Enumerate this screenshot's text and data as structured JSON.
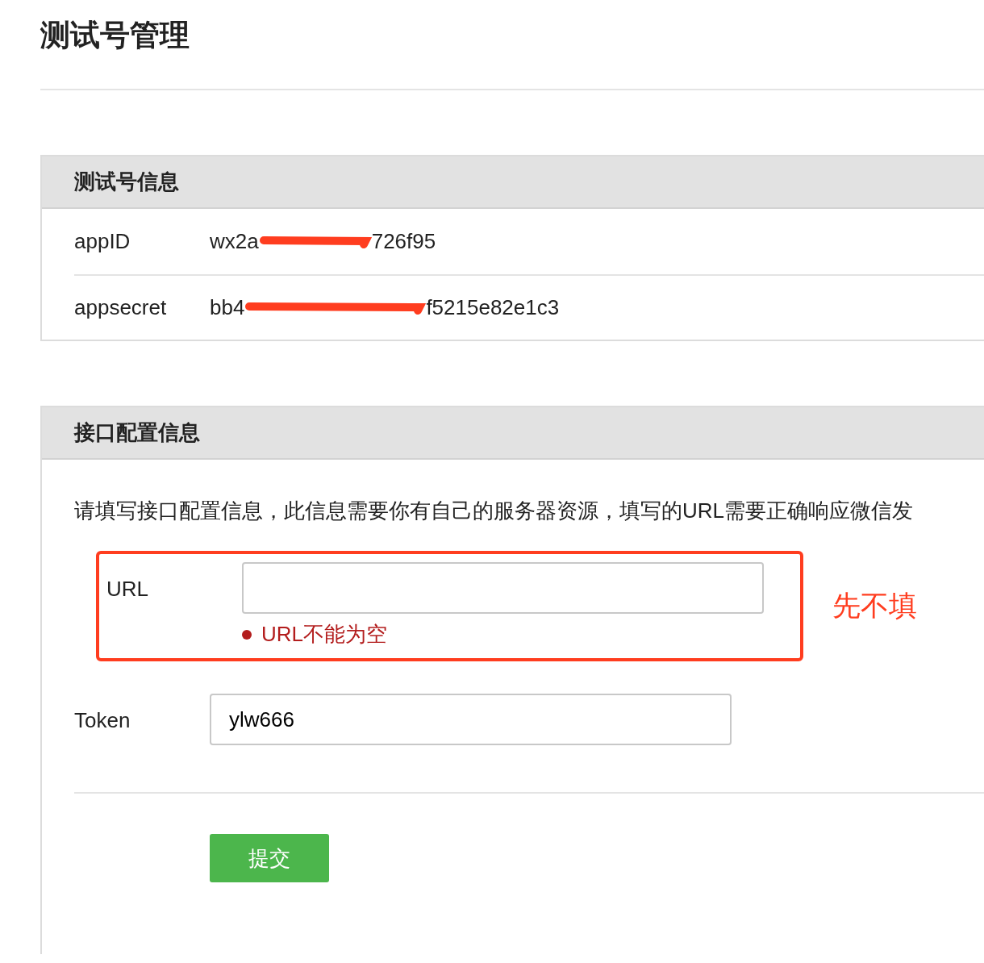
{
  "title": "测试号管理",
  "info_panel": {
    "heading": "测试号信息",
    "rows": [
      {
        "label": "appID",
        "value_start": "wx2a",
        "value_end": "726f95",
        "redacted": true
      },
      {
        "label": "appsecret",
        "value_start": "bb4",
        "value_end": "f5215e82e1c3",
        "redacted": true
      }
    ]
  },
  "config_panel": {
    "heading": "接口配置信息",
    "description": "请填写接口配置信息，此信息需要你有自己的服务器资源，填写的URL需要正确响应微信发",
    "fields": [
      {
        "label": "URL",
        "error": "URL不能为空",
        "highlighted": true
      },
      {
        "label": "Token",
        "value": "ylw666",
        "highlighted": false
      }
    ],
    "submit": "提交"
  },
  "annotation": "先不填"
}
